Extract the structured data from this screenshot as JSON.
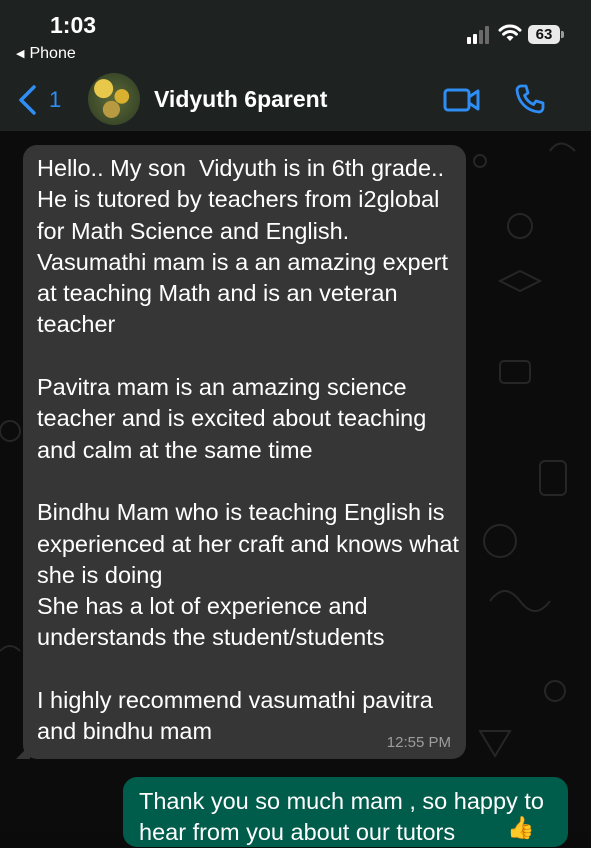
{
  "status_bar": {
    "time": "1:03",
    "back_app": "Phone",
    "battery": "63"
  },
  "header": {
    "back_count": "1",
    "contact_name": "Vidyuth 6parent"
  },
  "messages": {
    "incoming": {
      "text": "Hello.. My son  Vidyuth is in 6th grade.. He is tutored by teachers from i2global for Math Science and English. Vasumathi mam is a an amazing expert at teaching Math and is an veteran teacher\n\nPavitra mam is an amazing science teacher and is excited about teaching and calm at the same time\n\nBindhu Mam who is teaching English is experienced at her craft and knows what she is doing\nShe has a lot of experience and understands the student/students\n\nI highly recommend vasumathi pavitra and bindhu mam",
      "time": "12:55 PM"
    },
    "outgoing": {
      "text": "Thank you so much mam , so happy to hear from you about our tutors"
    }
  },
  "colors": {
    "accent": "#2e8ef5",
    "incoming_bubble": "#363636",
    "outgoing_bubble": "#005c4b",
    "header_bg": "#1e2220"
  },
  "icons": [
    "signal-icon",
    "wifi-icon",
    "battery-icon",
    "back-chevron-icon",
    "video-call-icon",
    "phone-call-icon",
    "thumbs-up-emoji"
  ]
}
